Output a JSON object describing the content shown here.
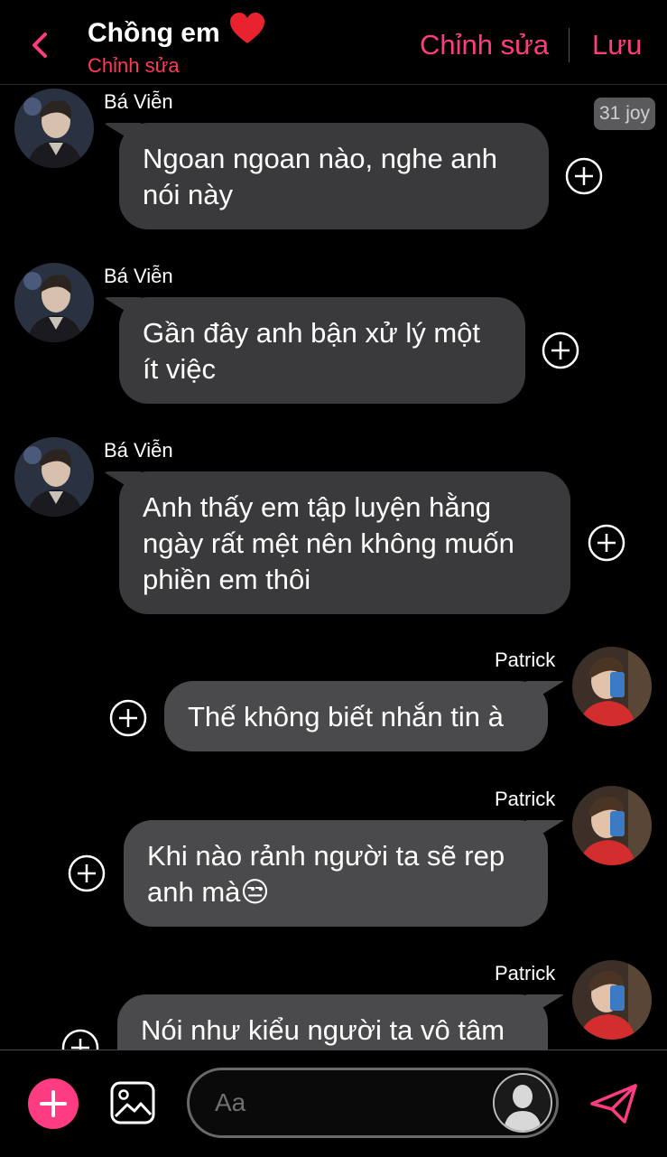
{
  "header": {
    "title": "Chồng em",
    "subtitle": "Chỉnh sửa",
    "edit_label": "Chỉnh sửa",
    "save_label": "Lưu"
  },
  "timestamp": "31 joy",
  "messages": [
    {
      "sender": "Bá Viễn",
      "side": "left",
      "lines": [
        "Ngoan ngoan nào, nghe anh",
        "nói này"
      ]
    },
    {
      "sender": "Bá Viễn",
      "side": "left",
      "lines": [
        "Gần đây anh bận xử lý một",
        "ít việc"
      ]
    },
    {
      "sender": "Bá Viễn",
      "side": "left",
      "lines": [
        "Anh thấy em tập luyện hằng",
        "ngày rất mệt nên không muốn",
        "phiền em thôi"
      ]
    },
    {
      "sender": "Patrick",
      "side": "right",
      "lines": [
        "Thế không biết nhắn tin à"
      ]
    },
    {
      "sender": "Patrick",
      "side": "right",
      "lines": [
        "Khi nào rảnh người ta sẽ rep",
        "anh mà😒"
      ]
    },
    {
      "sender": "Patrick",
      "side": "right",
      "lines": [
        "Nói như kiểu người ta vô tâm"
      ]
    }
  ],
  "composer": {
    "placeholder": "Aa"
  },
  "colors": {
    "accent": "#ff3b82",
    "subtitle": "#ff3b55",
    "bubble": "#3a3a3c",
    "background": "#000000"
  },
  "icons": [
    "back-chevron-icon",
    "heart-icon",
    "add-reaction-icon",
    "plus-icon",
    "image-icon",
    "default-avatar-icon",
    "send-icon"
  ]
}
